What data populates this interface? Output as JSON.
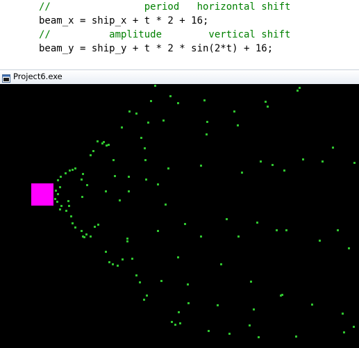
{
  "code": {
    "line1": "//                period   horizontal shift",
    "line2": "beam_x = ship_x + t * 2 + 16;",
    "line3": "//          amplitude        vertical shift",
    "line4": "beam_y = ship_y + t * 2 * sin(2*t) + 16;"
  },
  "window": {
    "title": "Project6.exe"
  },
  "colors": {
    "ship": "#ff00ff",
    "particle": "#2fc42f",
    "background": "#000000",
    "comment": "#008000"
  },
  "icons": {
    "app": "console-window-icon"
  }
}
